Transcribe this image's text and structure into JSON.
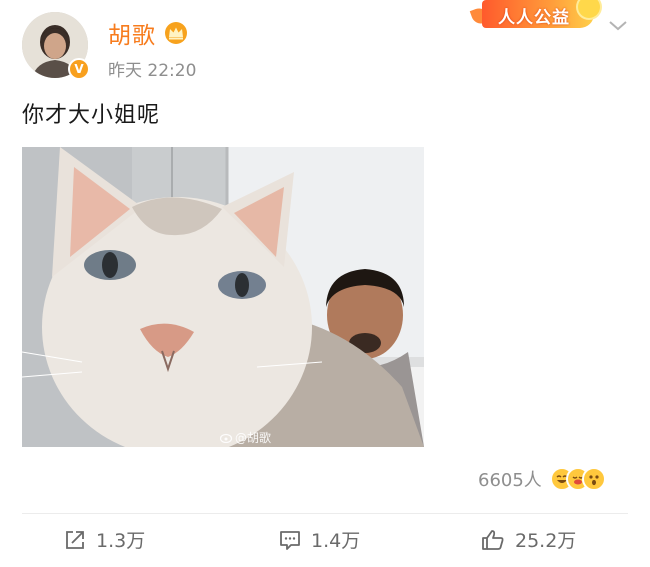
{
  "header": {
    "username": "胡歌",
    "time": "昨天 22:20",
    "verified_mark": "V",
    "charity_label": "人人公益"
  },
  "post": {
    "text": "你才大小姐呢",
    "image_watermark": "@胡歌"
  },
  "reactions": {
    "count": "6605人"
  },
  "actions": {
    "repost": "1.3万",
    "comment": "1.4万",
    "like": "25.2万"
  },
  "icons": {
    "avatar": "avatar-image",
    "verified": "verified-v-icon",
    "vip": "crown-icon",
    "more": "chevron-down-icon",
    "repost": "share-icon",
    "comment": "comment-icon",
    "like": "thumbs-up-icon"
  },
  "colors": {
    "username": "#f77c1e",
    "verified": "#f8a01e",
    "meta_text": "#8e8e8e",
    "action_text": "#6a6a6a"
  }
}
